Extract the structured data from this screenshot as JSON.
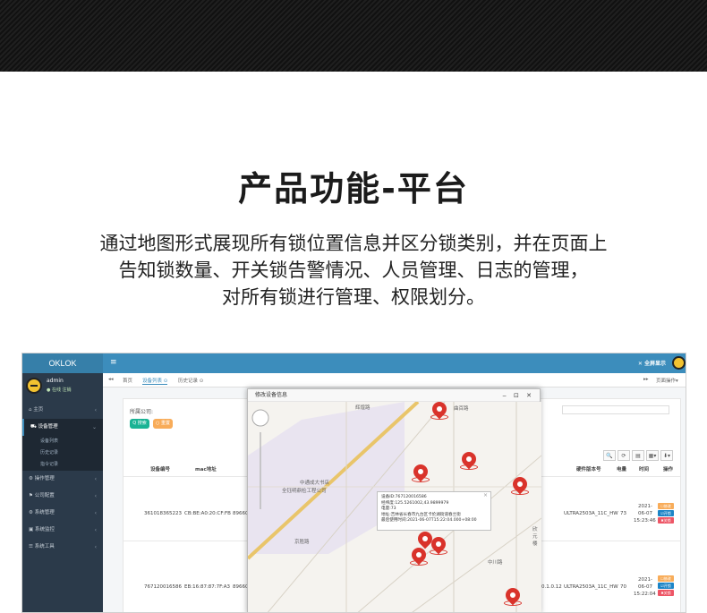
{
  "page": {
    "title": "产品功能-平台",
    "desc_lines": [
      "通过地图形式展现所有锁位置信息并区分锁类别，并在页面上",
      "告知锁数量、开关锁告警情况、人员管理、日志的管理，",
      "对所有锁进行管理、权限划分。"
    ]
  },
  "app": {
    "logo": "OKLOK",
    "user": {
      "name": "admin",
      "status": "● 在线",
      "logout": "注销"
    },
    "nav": [
      {
        "label": "主页"
      },
      {
        "label": "设备管理"
      },
      {
        "label": "设备列表"
      },
      {
        "label": "历史记录"
      },
      {
        "label": "指令记录"
      },
      {
        "label": "操作管理"
      },
      {
        "label": "公司配置"
      },
      {
        "label": "系统管理"
      },
      {
        "label": "系统监控"
      },
      {
        "label": "系统工具"
      }
    ],
    "topbar": {
      "menu_icon": "≡",
      "fullscreen": "✕ 全屏显示"
    },
    "tabs": {
      "back": "◂◂",
      "home": "首页",
      "device_list": "设备列表 ⊙",
      "history": "历史记录 ⊙",
      "forward": "▸▸",
      "page_ops": "页面操作▾"
    },
    "filter": {
      "company_label": "所属公司:",
      "search_btn": "Q 搜索",
      "reset_btn": "○ 重置"
    },
    "toolbar_icons": [
      "🔍",
      "⟳",
      "▤",
      "▦▾",
      "⬇▾"
    ],
    "columns": [
      "设备编号",
      "mac地址",
      "硬件版本号",
      "电量",
      "时间",
      "操作"
    ],
    "rows": [
      {
        "id": "361018365223",
        "mac": "CB:BE:A0:20:CF:FB",
        "extra": "89660",
        "hw": "ULTRA2503A_11C_HW",
        "battery": "73",
        "time": [
          "2021-",
          "06-07",
          "15:23:46"
        ]
      },
      {
        "id": "767120016586",
        "mac": "EB:16:87:87:7F:A3",
        "extra": "89660",
        "fw": "0.1.0.12",
        "hw": "ULTRA2503A_11C_HW",
        "battery": "70",
        "time": [
          "2021-",
          "06-07",
          "15:22:04"
        ]
      }
    ],
    "row_actions": {
      "edit": "☐修改",
      "open": "☑开锁",
      "close": "✖关锁"
    },
    "modal": {
      "title": "修改设备信息",
      "controls": "‒ ⊡ ✕",
      "info": {
        "lines": [
          "设备ID:767120016586",
          "经纬度:125.5261002,43.9899979",
          "电量:73",
          "地址:吉林省长春市九台区卡伦湖街道春兰街",
          "最后使用时间:2021-06-07T15:22:04.000+08:00"
        ]
      },
      "map_labels": [
        "曲百路",
        "中通成大书店",
        "全钰明鼎检工程公司",
        "中川路",
        "欣元楼",
        "辉煌路",
        "京胜路"
      ]
    }
  }
}
